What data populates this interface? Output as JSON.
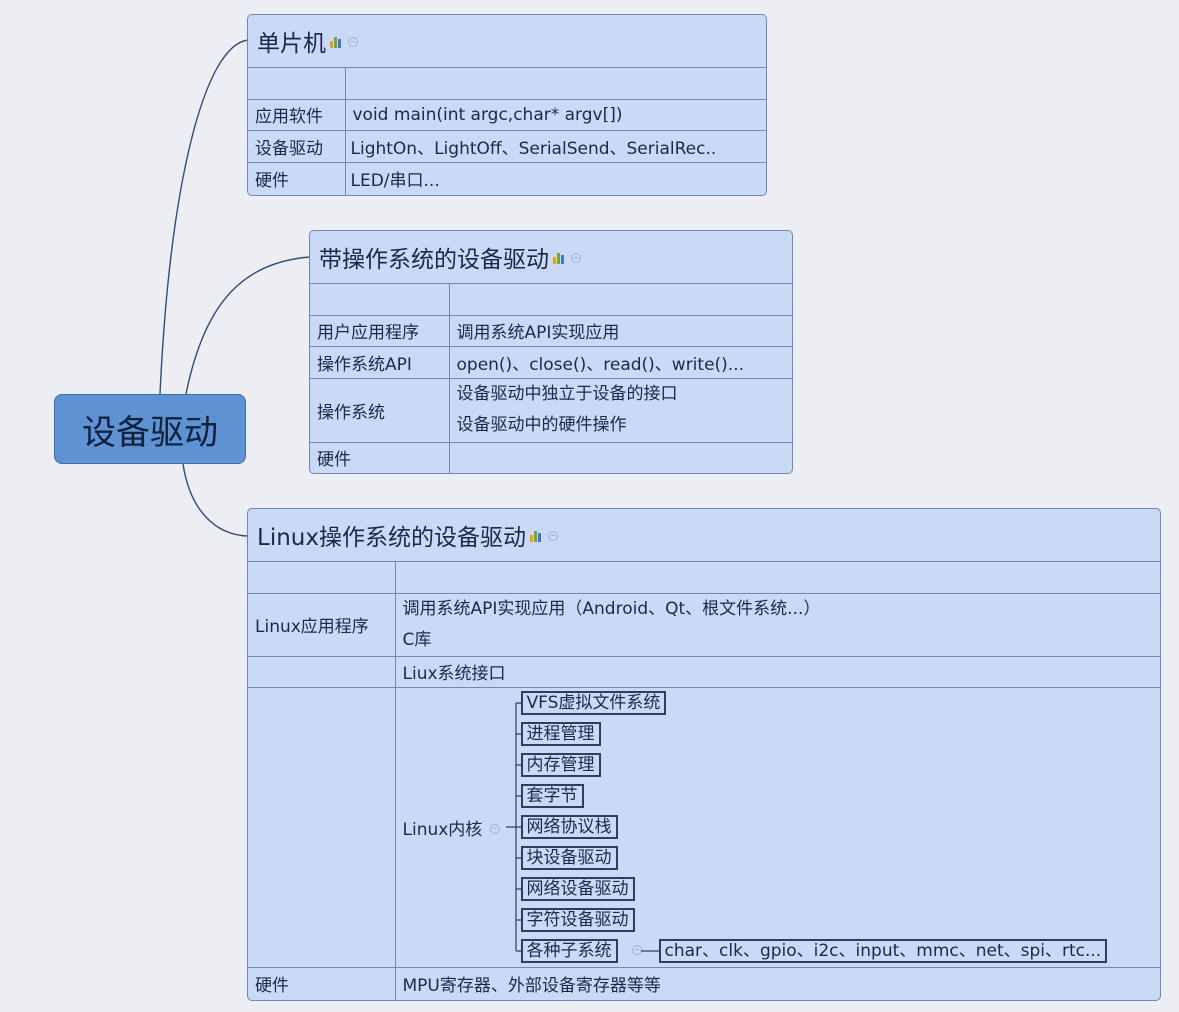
{
  "central": "设备驱动",
  "topics": {
    "mcu": {
      "title": "单片机",
      "rows": [
        [
          "",
          ""
        ],
        [
          "应用软件",
          "void main(int argc,char* argv[])"
        ],
        [
          "设备驱动",
          "LightOn、LightOff、SerialSend、SerialRec.."
        ],
        [
          "硬件",
          "LED/串口..."
        ]
      ]
    },
    "os": {
      "title": "带操作系统的设备驱动",
      "rows": [
        [
          "",
          ""
        ],
        [
          "用户应用程序",
          "调用系统API实现应用"
        ],
        [
          "操作系统API",
          "open()、close()、read()、write()..."
        ],
        [
          "操作系统",
          "设备驱动中独立于设备的接口",
          "设备驱动中的硬件操作"
        ],
        [
          "硬件",
          ""
        ]
      ]
    },
    "linux": {
      "title": "Linux操作系统的设备驱动",
      "app_label": "Linux应用程序",
      "app_line1": "调用系统API实现应用（Android、Qt、根文件系统...）",
      "app_line2": "C库",
      "syscall": "Liux系统接口",
      "kernel_label": "Linux内核",
      "kernel_subsystems": [
        "VFS虚拟文件系统",
        "进程管理",
        "内存管理",
        "套字节",
        "网络协议栈",
        "块设备驱动",
        "网络设备驱动",
        "字符设备驱动",
        "各种子系统"
      ],
      "subsystem_detail": "char、clk、gpio、i2c、input、mmc、net、spi、rtc...",
      "hw_label": "硬件",
      "hw_value": "MPU寄存器、外部设备寄存器等等"
    }
  }
}
